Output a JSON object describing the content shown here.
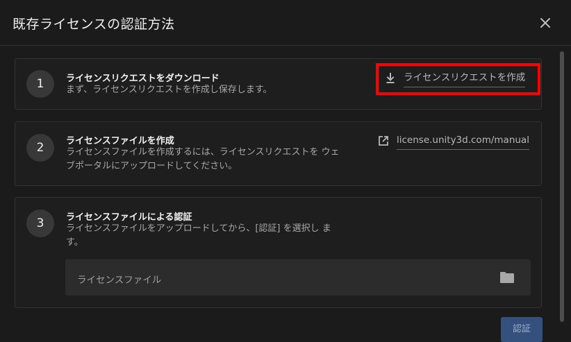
{
  "dialog": {
    "title": "既存ライセンスの認証方法"
  },
  "steps": [
    {
      "number": "1",
      "title": "ライセンスリクエストをダウンロード",
      "description": "まず、ライセンスリクエストを作成し保存します。",
      "action": {
        "label": "ライセンスリクエストを作成",
        "icon": "download-icon"
      }
    },
    {
      "number": "2",
      "title": "ライセンスファイルを作成",
      "description": "ライセンスファイルを作成するには、ライセンスリクエストを ウェブポータルにアップロードしてください。",
      "action": {
        "label": "license.unity3d.com/manual",
        "icon": "external-link-icon"
      }
    },
    {
      "number": "3",
      "title": "ライセンスファイルによる認証",
      "description": "ライセンスファイルをアップロードしてから、[認証] を選択し ます。",
      "file_field": {
        "placeholder": "ライセンスファイル",
        "icon": "folder-icon"
      }
    }
  ],
  "footer": {
    "confirm_label": "認証"
  },
  "colors": {
    "background": "#1b1b1b",
    "highlight": "#ff0000",
    "primary_button": "#33517c"
  }
}
